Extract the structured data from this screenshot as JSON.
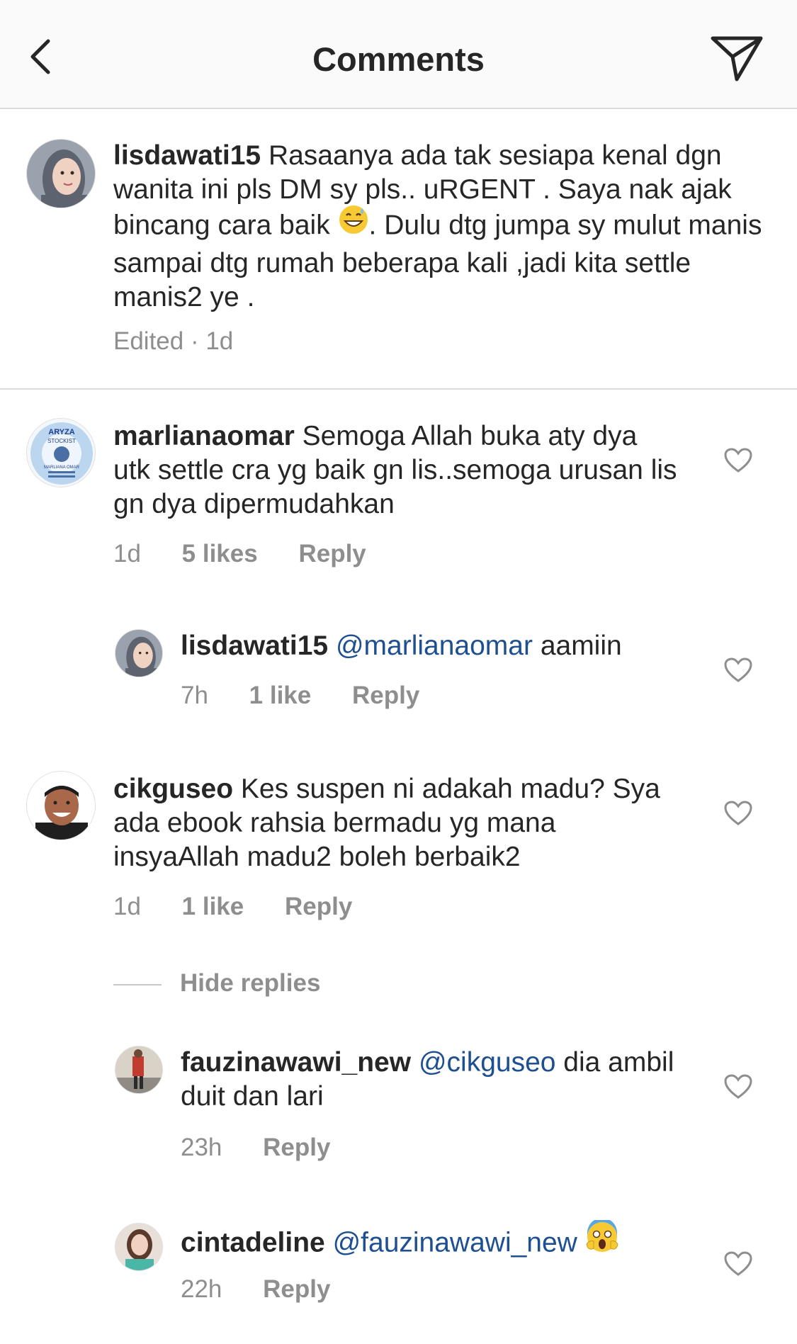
{
  "header": {
    "title": "Comments"
  },
  "caption": {
    "username": "lisdawati15",
    "text_1": "Rasaanya ada tak sesiapa kenal dgn wanita ini pls DM sy pls.. uRGENT . Saya nak ajak bincang cara baik",
    "text_2": ". Dulu dtg jumpa sy mulut manis sampai dtg rumah beberapa kali ,jadi  kita settle manis2 ye .",
    "meta": "Edited · 1d"
  },
  "comments": [
    {
      "username": "marlianaomar",
      "text": "Semoga Allah buka aty dya utk settle cra yg baik gn lis..semoga urusan lis gn dya dipermudahkan",
      "time": "1d",
      "likes": "5 likes",
      "reply": "Reply",
      "avatar_text": [
        "ARYZA",
        "STOCKIST",
        "MARLIANA OMAR"
      ]
    },
    {
      "username": "lisdawati15",
      "mention": "@marlianaomar",
      "text": "aamiin",
      "time": "7h",
      "likes": "1 like",
      "reply": "Reply"
    },
    {
      "username": "cikguseo",
      "text": "Kes suspen ni adakah madu? Sya ada ebook rahsia bermadu yg mana insyaAllah madu2 boleh berbaik2",
      "time": "1d",
      "likes": "1 like",
      "reply": "Reply"
    },
    {
      "username": "fauzinawawi_new",
      "mention": "@cikguseo",
      "text": "dia ambil duit dan lari",
      "time": "23h",
      "reply": "Reply"
    },
    {
      "username": "cintadeline",
      "mention": "@fauzinawawi_new",
      "time": "22h",
      "reply": "Reply"
    }
  ],
  "hide_replies": "Hide replies",
  "colors": {
    "text": "#262626",
    "secondary": "#8e8e8e",
    "mention": "#1d4f91",
    "divider": "#dbdbdb"
  },
  "icons": [
    "back-chevron-icon",
    "send-direct-icon",
    "heart-icon",
    "grinning-sweat-emoji",
    "screaming-face-emoji"
  ]
}
